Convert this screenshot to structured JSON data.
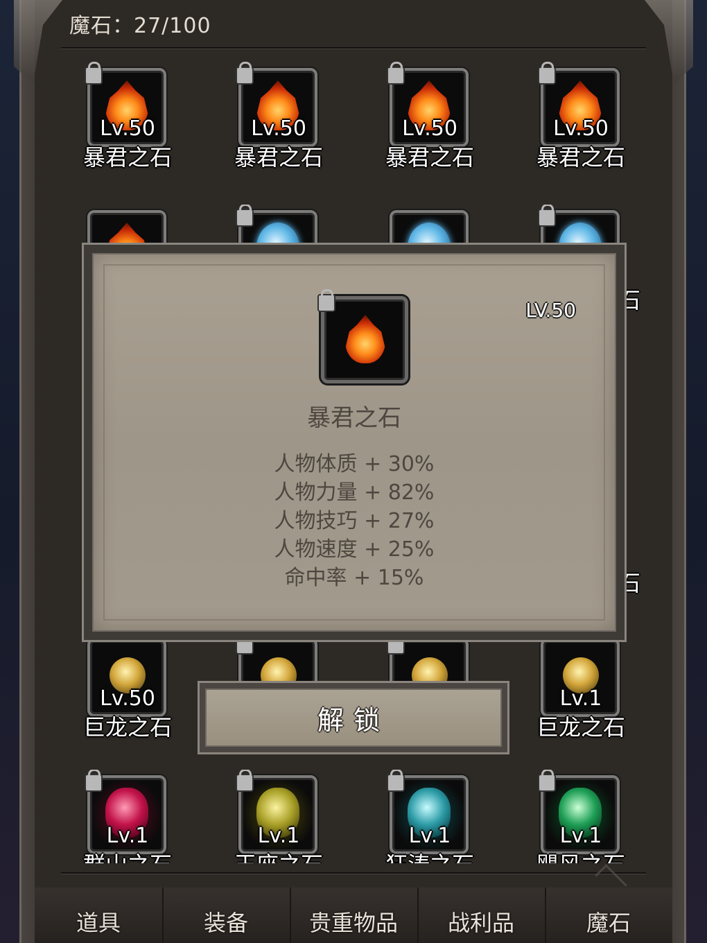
{
  "header": {
    "magic_stone_label": "魔石：",
    "magic_stone_count": "27/100"
  },
  "grid_row1": [
    {
      "level": "Lv.50",
      "name": "暴君之石",
      "gem": "fire-gem-icon"
    },
    {
      "level": "Lv.50",
      "name": "暴君之石",
      "gem": "fire-gem-icon"
    },
    {
      "level": "Lv.50",
      "name": "暴君之石",
      "gem": "fire-gem-icon"
    },
    {
      "level": "Lv.50",
      "name": "暴君之石",
      "gem": "fire-gem-icon"
    }
  ],
  "grid_row3": [
    {
      "level": "Lv.50",
      "name": "巨龙之石",
      "gem": "dragon-gem-icon"
    },
    {
      "level": "",
      "name": "",
      "gem": "dragon-gem-icon"
    },
    {
      "level": "",
      "name": "",
      "gem": "dragon-gem-icon"
    },
    {
      "level": "Lv.1",
      "name": "巨龙之石",
      "gem": "dragon-gem-icon"
    }
  ],
  "grid_row4": [
    {
      "level": "Lv.1",
      "name": "群山之石",
      "gem": "red-crystal-icon"
    },
    {
      "level": "Lv.1",
      "name": "王座之石",
      "gem": "yellow-crystal-icon"
    },
    {
      "level": "Lv.1",
      "name": "狂涛之石",
      "gem": "cyan-crystal-icon"
    },
    {
      "level": "Lv.1",
      "name": "飓风之石",
      "gem": "green-crystal-icon"
    }
  ],
  "popup": {
    "level": "LV.50",
    "name": "暴君之石",
    "stats": [
      "人物体质 + 30%",
      "人物力量 + 82%",
      "人物技巧 + 27%",
      "人物速度 + 25%",
      "命中率 + 15%"
    ],
    "edge_chars": [
      "石",
      "石"
    ]
  },
  "unlock_button": {
    "label": "解锁"
  },
  "nav": {
    "items": [
      "道具",
      "装备",
      "贵重物品",
      "战利品",
      "魔石"
    ]
  }
}
